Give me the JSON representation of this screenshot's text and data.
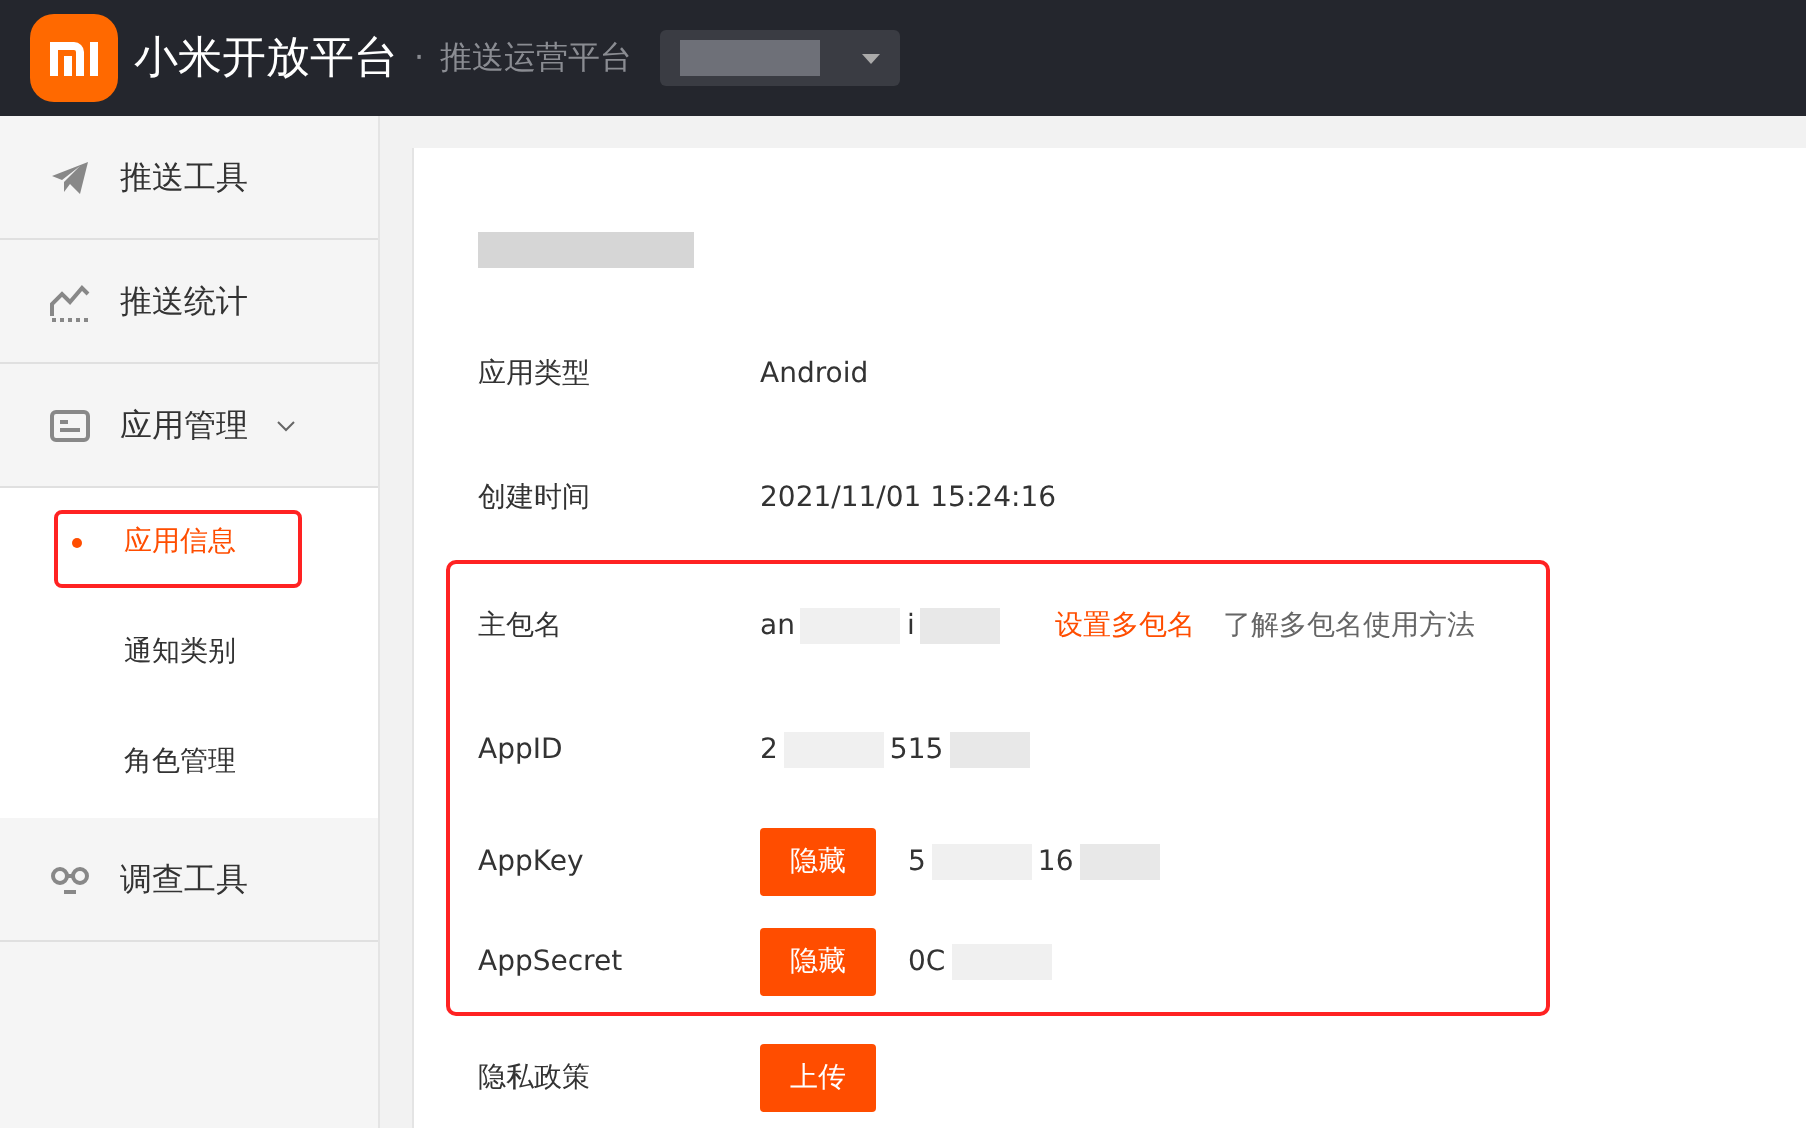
{
  "header": {
    "logo_text": "小米开放平台",
    "separator": "·",
    "subtitle": "推送运营平台"
  },
  "sidebar": {
    "items": [
      {
        "label": "推送工具"
      },
      {
        "label": "推送统计"
      },
      {
        "label": "应用管理",
        "expanded": true,
        "children": [
          {
            "label": "应用信息",
            "selected": true,
            "highlighted": true
          },
          {
            "label": "通知类别",
            "selected": false,
            "highlighted": false
          },
          {
            "label": "角色管理",
            "selected": false,
            "highlighted": false
          }
        ]
      },
      {
        "label": "调查工具"
      }
    ]
  },
  "content": {
    "rows": [
      {
        "label": "应用类型",
        "value": "Android",
        "highlighted": false
      },
      {
        "label": "创建时间",
        "value": "2021/11/01 15:24:16",
        "highlighted": false
      },
      {
        "label": "主包名",
        "value_fragments": [
          "an",
          "i"
        ],
        "links": [
          {
            "text": "设置多包名",
            "kind": "accent"
          },
          {
            "text": "了解多包名使用方法",
            "kind": "muted"
          }
        ],
        "highlighted": true
      },
      {
        "label": "AppID",
        "value_fragments": [
          "2",
          "515"
        ],
        "highlighted": true
      },
      {
        "label": "AppKey",
        "button": "隐藏",
        "value_fragments": [
          "5",
          "16"
        ],
        "highlighted": true
      },
      {
        "label": "AppSecret",
        "button": "隐藏",
        "value_fragments": [
          "0C"
        ],
        "highlighted": true
      },
      {
        "label": "隐私政策",
        "button": "上传",
        "highlighted": false
      }
    ]
  }
}
